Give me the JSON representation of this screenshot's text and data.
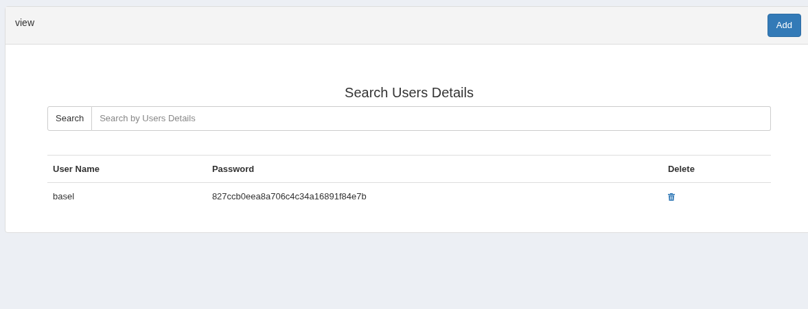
{
  "header": {
    "title": "view",
    "add_button": "Add"
  },
  "search": {
    "title": "Search Users Details",
    "label": "Search",
    "placeholder": "Search by Users Details"
  },
  "table": {
    "columns": [
      "User Name",
      "Password",
      "Delete"
    ],
    "rows": [
      {
        "user_name": "basel",
        "password": "827ccb0eea8a706c4c34a16891f84e7b"
      }
    ]
  }
}
